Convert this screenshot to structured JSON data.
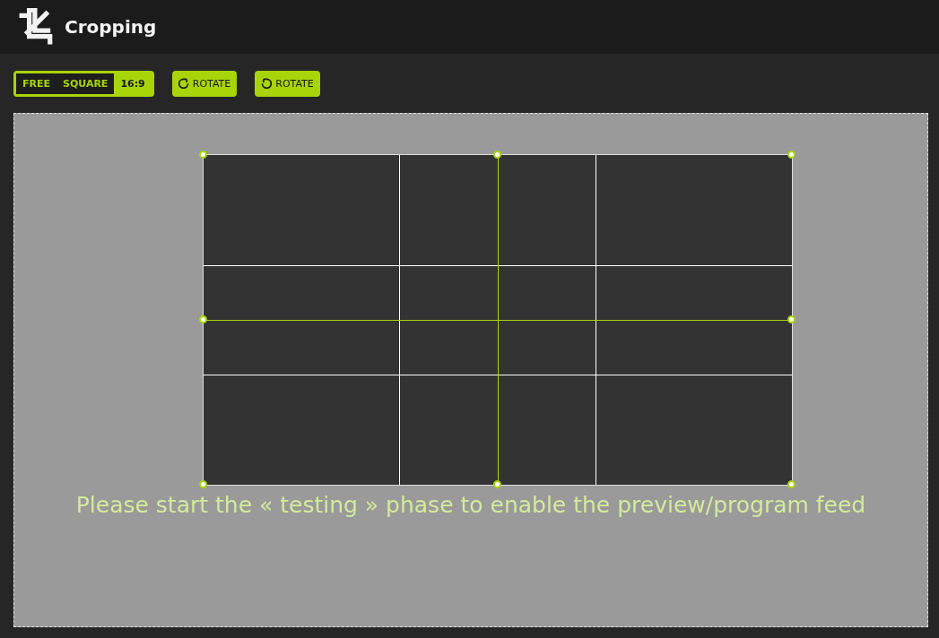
{
  "header": {
    "title": "Cropping"
  },
  "aspect_modes": [
    {
      "label": "FREE",
      "selected": false
    },
    {
      "label": "SQUARE",
      "selected": false
    },
    {
      "label": "16:9",
      "selected": true
    }
  ],
  "rotate_buttons": [
    {
      "label": "ROTATE",
      "kind": "clockwise"
    },
    {
      "label": "ROTATE",
      "kind": "counterclockwise"
    }
  ],
  "canvas": {
    "message": "Please start the « testing » phase to enable the preview/program feed"
  }
}
